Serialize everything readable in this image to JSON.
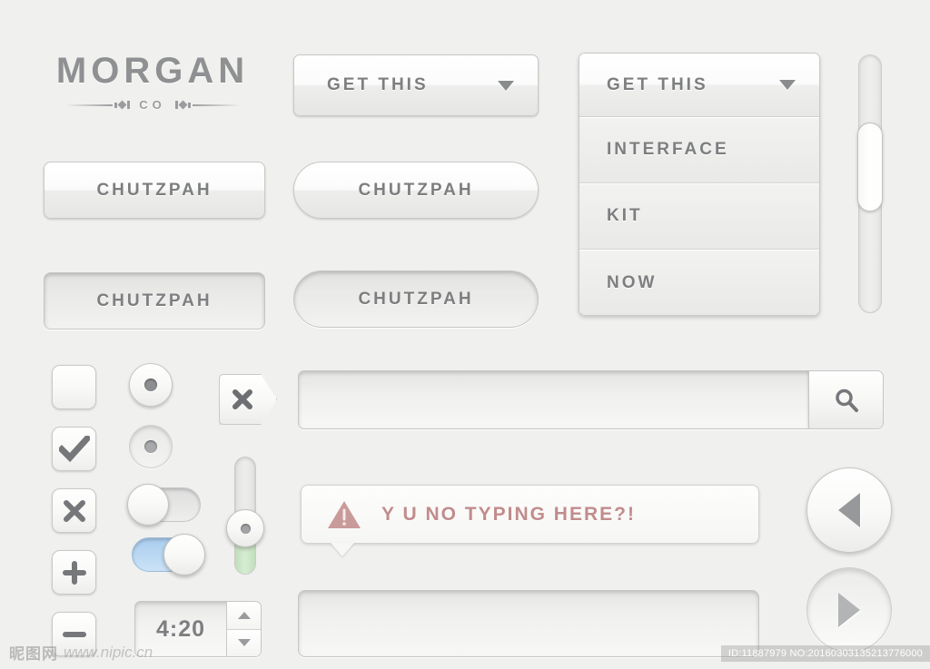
{
  "logo": {
    "word": "MORGAN",
    "sub": "CO"
  },
  "dropdown_button": {
    "label": "GET THIS",
    "caret_icon": "chevron-down-icon"
  },
  "dropdown_open": {
    "header": "GET THIS",
    "caret_icon": "chevron-down-icon",
    "items": [
      {
        "label": "INTERFACE"
      },
      {
        "label": "KIT"
      },
      {
        "label": "NOW"
      }
    ]
  },
  "buttons": {
    "rect_normal": "CHUTZPAH",
    "pill_normal": "CHUTZPAH",
    "rect_pressed": "CHUTZPAH",
    "pill_pressed": "CHUTZPAH"
  },
  "checkboxes": [
    {
      "name": "checkbox-empty",
      "icon": "none"
    },
    {
      "name": "checkbox-checked",
      "icon": "check-icon"
    },
    {
      "name": "checkbox-cross",
      "icon": "cross-icon"
    },
    {
      "name": "checkbox-plus",
      "icon": "plus-icon"
    },
    {
      "name": "checkbox-minus",
      "icon": "minus-icon"
    }
  ],
  "radios": [
    {
      "name": "radio-selected",
      "state": "raised"
    },
    {
      "name": "radio-pressed",
      "state": "inset"
    }
  ],
  "toggles": [
    {
      "name": "toggle-off",
      "state": "off",
      "track_color": "#e2e2e0"
    },
    {
      "name": "toggle-on",
      "state": "on",
      "track_color": "#a9cdee"
    }
  ],
  "slider": {
    "fill_color": "#c2debd",
    "fill_percent": 42
  },
  "scrollbar": {
    "thumb_position_percent": 26
  },
  "tag_close": {
    "icon": "close-icon"
  },
  "search": {
    "value": "",
    "placeholder": "",
    "button_icon": "search-icon"
  },
  "tooltip": {
    "icon": "warning-triangle-icon",
    "text": "Y U NO TYPING HERE?!",
    "text_color": "#c08c8c"
  },
  "stepper": {
    "value": "4:20",
    "up_icon": "triangle-up-icon",
    "down_icon": "triangle-down-icon"
  },
  "textarea": {
    "value": "",
    "placeholder": ""
  },
  "nav": {
    "prev": {
      "icon": "triangle-left-icon",
      "state": "raised"
    },
    "next": {
      "icon": "triangle-right-icon",
      "state": "inset"
    }
  },
  "watermark": {
    "cn": "昵图网",
    "url": "www.nipic.cn",
    "id_text": "ID:11887979 NO:20160303135213776000"
  }
}
